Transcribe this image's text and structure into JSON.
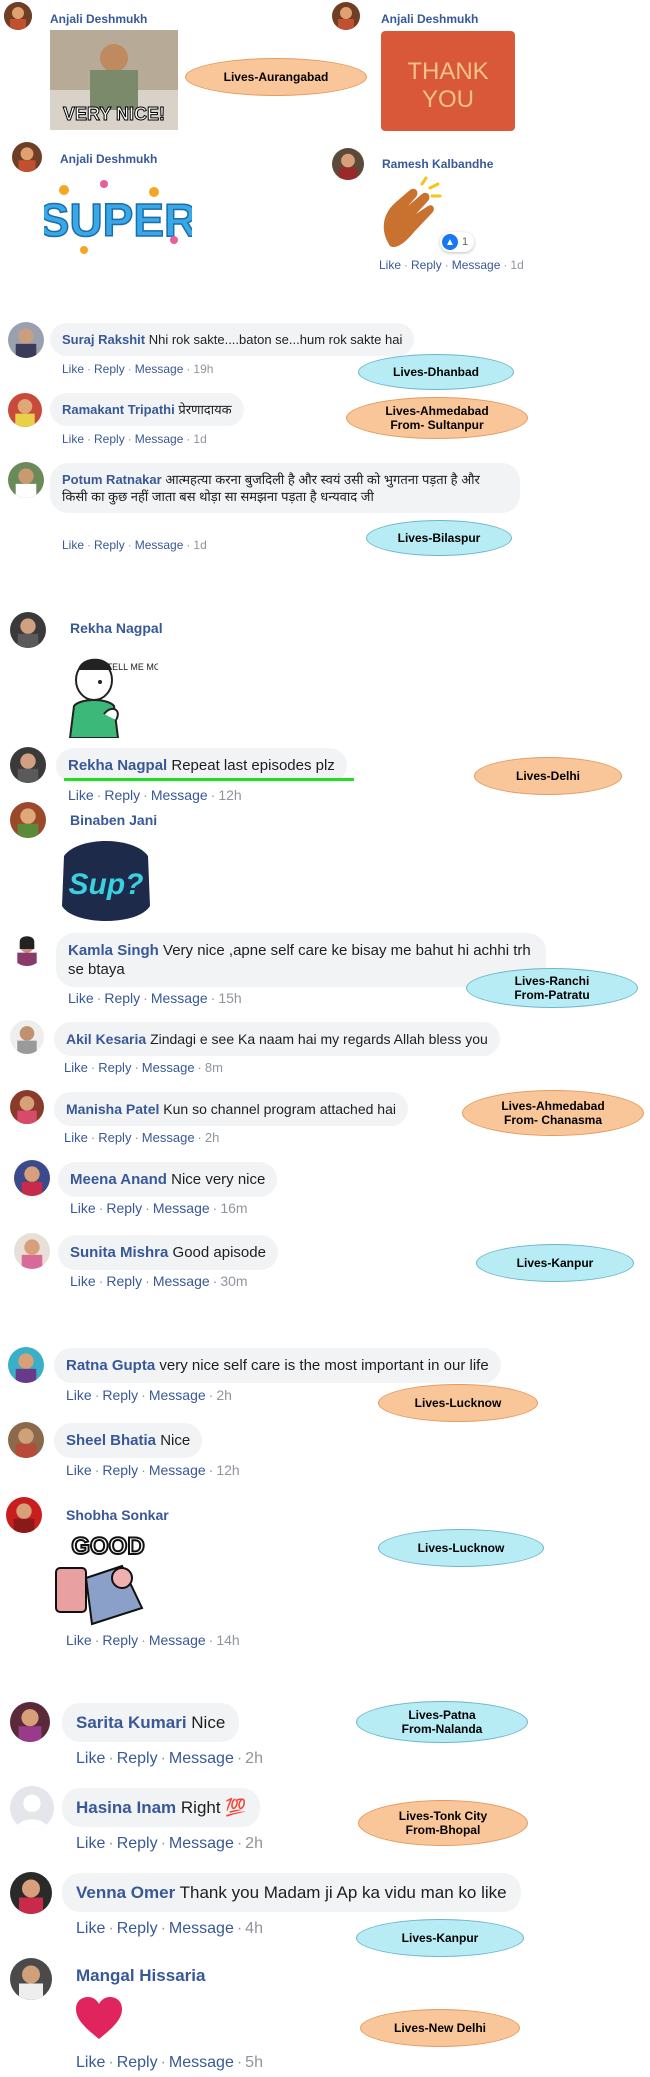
{
  "top": {
    "anjali1_name": "Anjali Deshmukh",
    "anjali2_name": "Anjali Deshmukh",
    "anjali3_name": "Anjali Deshmukh",
    "ramesh_name": "Ramesh Kalbandhe",
    "very_nice_text": "VERY NICE!",
    "thank_you_line1": "THANK",
    "thank_you_line2": "YOU",
    "super_text": "SUPER",
    "reaction_count": "1",
    "ramesh_actions": {
      "like": "Like",
      "reply": "Reply",
      "message": "Message",
      "time": "1d"
    },
    "tag": "Lives-Aurangabad"
  },
  "c1": {
    "name": "Suraj Rakshit",
    "text": "Nhi rok sakte....baton se...hum rok sakte hai",
    "like": "Like",
    "reply": "Reply",
    "message": "Message",
    "time": "19h",
    "tag": "Lives-Dhanbad"
  },
  "c2": {
    "name": "Ramakant Tripathi",
    "text": "प्रेरणादायक",
    "like": "Like",
    "reply": "Reply",
    "message": "Message",
    "time": "1d",
    "tag_l1": "Lives-Ahmedabad",
    "tag_l2": "From- Sultanpur"
  },
  "c3": {
    "name": "Potum Ratnakar",
    "text": "आत्महत्या करना बुजदिली है और स्वयं उसी को भुगतना पड़ता है और किसी का कुछ नहीं जाता बस थोड़ा सा समझना पड़ता है धन्यवाद जी",
    "like": "Like",
    "reply": "Reply",
    "message": "Message",
    "time": "1d",
    "tag": "Lives-Bilaspur"
  },
  "c4": {
    "name": "Rekha Nagpal",
    "sticker_text": "TELL ME MORE"
  },
  "c5": {
    "name": "Rekha Nagpal",
    "text": "Repeat last episodes plz",
    "like": "Like",
    "reply": "Reply",
    "message": "Message",
    "time": "12h",
    "tag": "Lives-Delhi"
  },
  "c6": {
    "name": "Binaben Jani",
    "sticker_text": "Sup?",
    "like": "Like",
    "reply": "Reply",
    "message": "Message",
    "time": "15h"
  },
  "c7": {
    "name": "Kamla Singh",
    "text": "Very nice ,apne self care ke bisay me bahut hi achhi trh se btaya",
    "tag_l1": "Lives-Ranchi",
    "tag_l2": "From-Patratu"
  },
  "c8": {
    "name": "Akil Kesaria",
    "text": "Zindagi e see Ka naam hai my regards Allah bless you",
    "like": "Like",
    "reply": "Reply",
    "message": "Message",
    "time": "8m"
  },
  "c9": {
    "name": "Manisha Patel",
    "text": "Kun so channel program attached hai",
    "like": "Like",
    "reply": "Reply",
    "message": "Message",
    "time": "2h",
    "tag_l1": "Lives-Ahmedabad",
    "tag_l2": "From- Chanasma"
  },
  "c10": {
    "name": "Meena Anand",
    "text": "Nice very nice",
    "like": "Like",
    "reply": "Reply",
    "message": "Message",
    "time": "16m"
  },
  "c11": {
    "name": "Sunita Mishra",
    "text": "Good apisode",
    "like": "Like",
    "reply": "Reply",
    "message": "Message",
    "time": "30m",
    "tag": "Lives-Kanpur"
  },
  "c12": {
    "name": "Ratna Gupta",
    "text": "very nice self care is the most important in our life",
    "like": "Like",
    "reply": "Reply",
    "message": "Message",
    "time": "2h",
    "tag": "Lives-Lucknow"
  },
  "c13": {
    "name": "Sheel Bhatia",
    "text": "Nice",
    "like": "Like",
    "reply": "Reply",
    "message": "Message",
    "time": "12h"
  },
  "c14": {
    "name": "Shobha Sonkar",
    "sticker_text": "GOOD",
    "like": "Like",
    "reply": "Reply",
    "message": "Message",
    "time": "14h",
    "tag": "Lives-Lucknow"
  },
  "c15": {
    "name": "Sarita Kumari",
    "text": "Nice",
    "like": "Like",
    "reply": "Reply",
    "message": "Message",
    "time": "2h",
    "tag_l1": "Lives-Patna",
    "tag_l2": "From-Nalanda"
  },
  "c16": {
    "name": "Hasina Inam",
    "text": "Right 💯",
    "like": "Like",
    "reply": "Reply",
    "message": "Message",
    "time": "2h",
    "tag_l1": "Lives-Tonk City",
    "tag_l2": "From-Bhopal"
  },
  "c17": {
    "name": "Venna Omer",
    "text": "Thank you Madam ji Ap ka vidu man ko like",
    "like": "Like",
    "reply": "Reply",
    "message": "Message",
    "time": "4h",
    "tag": "Lives-Kanpur"
  },
  "c18": {
    "name": "Mangal Hissaria",
    "like": "Like",
    "reply": "Reply",
    "message": "Message",
    "time": "5h",
    "tag": "Lives-New Delhi"
  },
  "colors": {
    "link": "#385898",
    "bubble": "#f2f3f5",
    "tag_orange": "#f9c69a",
    "tag_blue": "#b7ecf5",
    "highlight": "#22dd22"
  }
}
